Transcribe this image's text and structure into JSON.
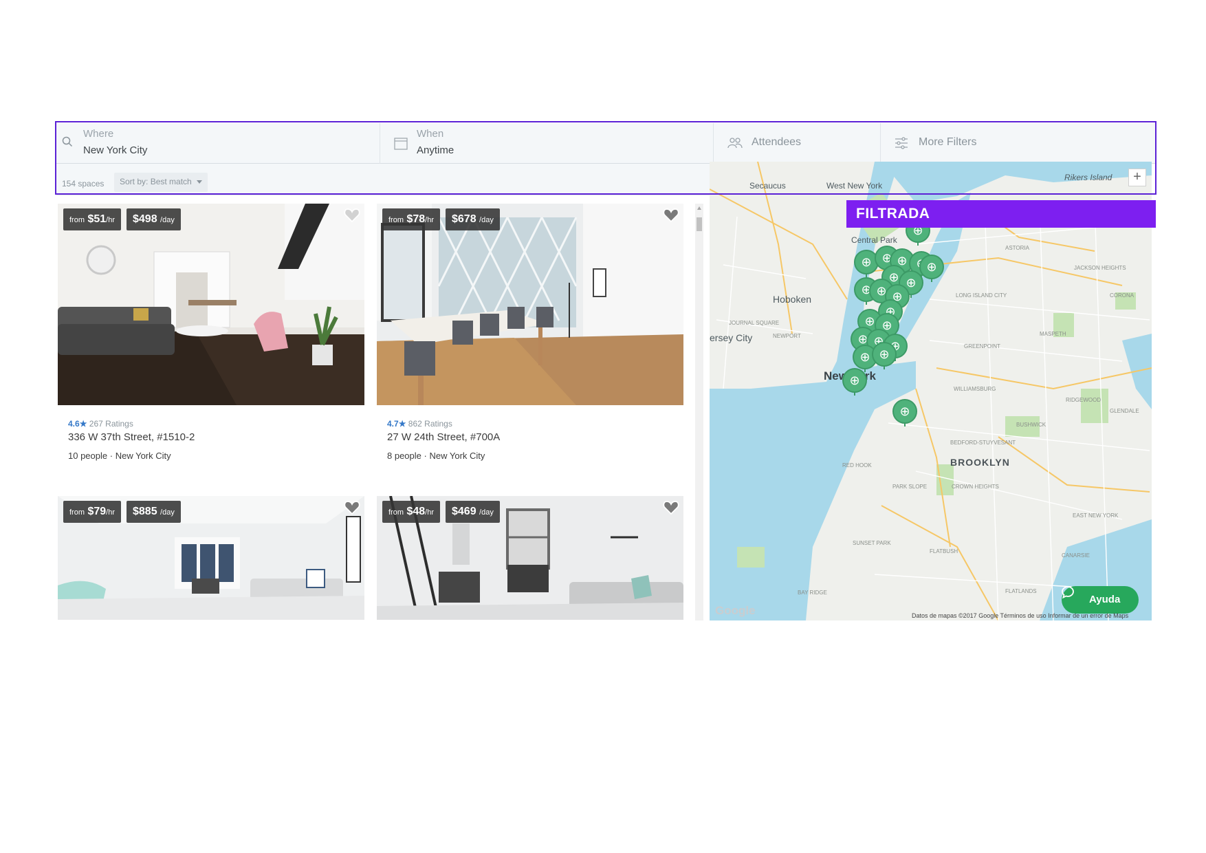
{
  "search": {
    "where_label": "Where",
    "where_value": "New York City",
    "when_label": "When",
    "when_value": "Anytime",
    "attendees_label": "Attendees",
    "more_filters_label": "More Filters"
  },
  "results": {
    "count": "154 spaces",
    "sort_label": "Sort by:",
    "sort_value": "Best match"
  },
  "listings": [
    {
      "hourly_prefix": "from",
      "hourly_price": "$51",
      "hourly_unit": "/hr",
      "daily_price": "$498",
      "daily_unit": "/day",
      "rating": "4.6",
      "star": "★",
      "ratings_count": "267 Ratings",
      "address": "336 W 37th Street, #1510-2",
      "capacity": "10 people",
      "separator": "·",
      "city": "New York City"
    },
    {
      "hourly_prefix": "from",
      "hourly_price": "$78",
      "hourly_unit": "/hr",
      "daily_price": "$678",
      "daily_unit": "/day",
      "rating": "4.7",
      "star": "★",
      "ratings_count": "862 Ratings",
      "address": "27 W 24th Street, #700A",
      "capacity": "8 people",
      "separator": "·",
      "city": "New York City"
    },
    {
      "hourly_prefix": "from",
      "hourly_price": "$79",
      "hourly_unit": "/hr",
      "daily_price": "$885",
      "daily_unit": "/day"
    },
    {
      "hourly_prefix": "from",
      "hourly_price": "$48",
      "hourly_unit": "/hr",
      "daily_price": "$469",
      "daily_unit": "/day"
    }
  ],
  "map": {
    "labels": {
      "secaucus": "Secaucus",
      "west_new_york": "West New York",
      "rikers_island": "Rikers Island",
      "central_park": "Central Park",
      "hoboken": "Hoboken",
      "jersey_city": "ersey City",
      "new_york": "New York",
      "brooklyn": "BROOKLYN",
      "astoria": "ASTORIA",
      "long_island_city": "LONG ISLAND CITY",
      "greenpoint": "GREENPOINT",
      "williamsburg": "WILLIAMSBURG",
      "maspeth": "MASPETH",
      "jackson_heights": "JACKSON HEIGHTS",
      "corona": "CORONA",
      "red_hook": "RED HOOK",
      "crown_heights": "CROWN HEIGHTS",
      "park_slope": "PARK SLOPE",
      "flatbush": "FLATBUSH",
      "east_new_york": "EAST NEW YORK",
      "canarsie": "CANARSIE",
      "sunset_park": "SUNSET PARK",
      "bay_ridge": "BAY RIDGE",
      "flatlands": "FLATLANDS",
      "bedford_stuyvesant": "BEDFORD-STUYVESANT",
      "bushwick": "BUSHWICK",
      "ridgewood": "RIDGEWOOD",
      "glendale": "GLENDALE",
      "newport": "NEWPORT",
      "journal_square": "JOURNAL SQUARE"
    },
    "zoom_in": "+",
    "help_button": "Ayuda",
    "google_logo": "Google",
    "attribution": "Datos de mapas ©2017 Google   Términos de uso   Informar de un error de Maps",
    "pin_glyph": "⊕"
  },
  "overlay_label": "FILTRADA",
  "colors": {
    "highlight": "#5b21d6",
    "overlay": "#7d1ff0",
    "pin": "#4fb27b",
    "help": "#27a85c",
    "rating": "#3478c8"
  },
  "icons": {
    "search": "search-icon",
    "calendar": "calendar-icon",
    "attendees": "people-icon",
    "filters": "sliders-icon",
    "heart": "heart-icon",
    "chat": "chat-icon"
  }
}
